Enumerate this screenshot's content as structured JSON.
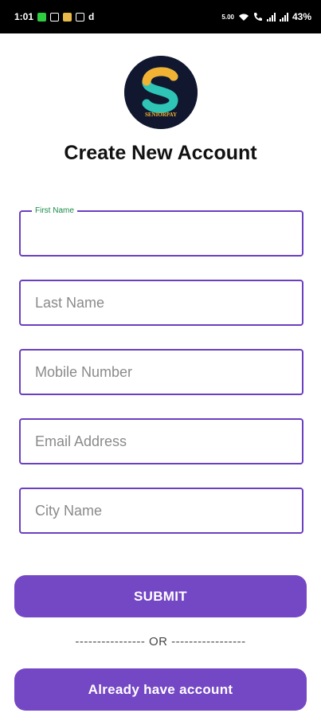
{
  "status_bar": {
    "time": "1:01",
    "app_letter": "d",
    "speed": "5.00",
    "battery": "43%"
  },
  "logo": {
    "letter": "S",
    "text": "SENIORPAY"
  },
  "page_title": "Create New Account",
  "form": {
    "first_name": {
      "label": "First Name",
      "value": ""
    },
    "last_name": {
      "placeholder": "Last Name"
    },
    "mobile": {
      "placeholder": "Mobile Number"
    },
    "email": {
      "placeholder": "Email Address"
    },
    "city": {
      "placeholder": "City Name"
    }
  },
  "submit_label": "SUBMIT",
  "divider_text": "---------------- OR -----------------",
  "login_label": "Already have account",
  "colors": {
    "primary": "#7447c4",
    "field_border": "#6a3fc0",
    "label_green": "#1a8a4a"
  }
}
